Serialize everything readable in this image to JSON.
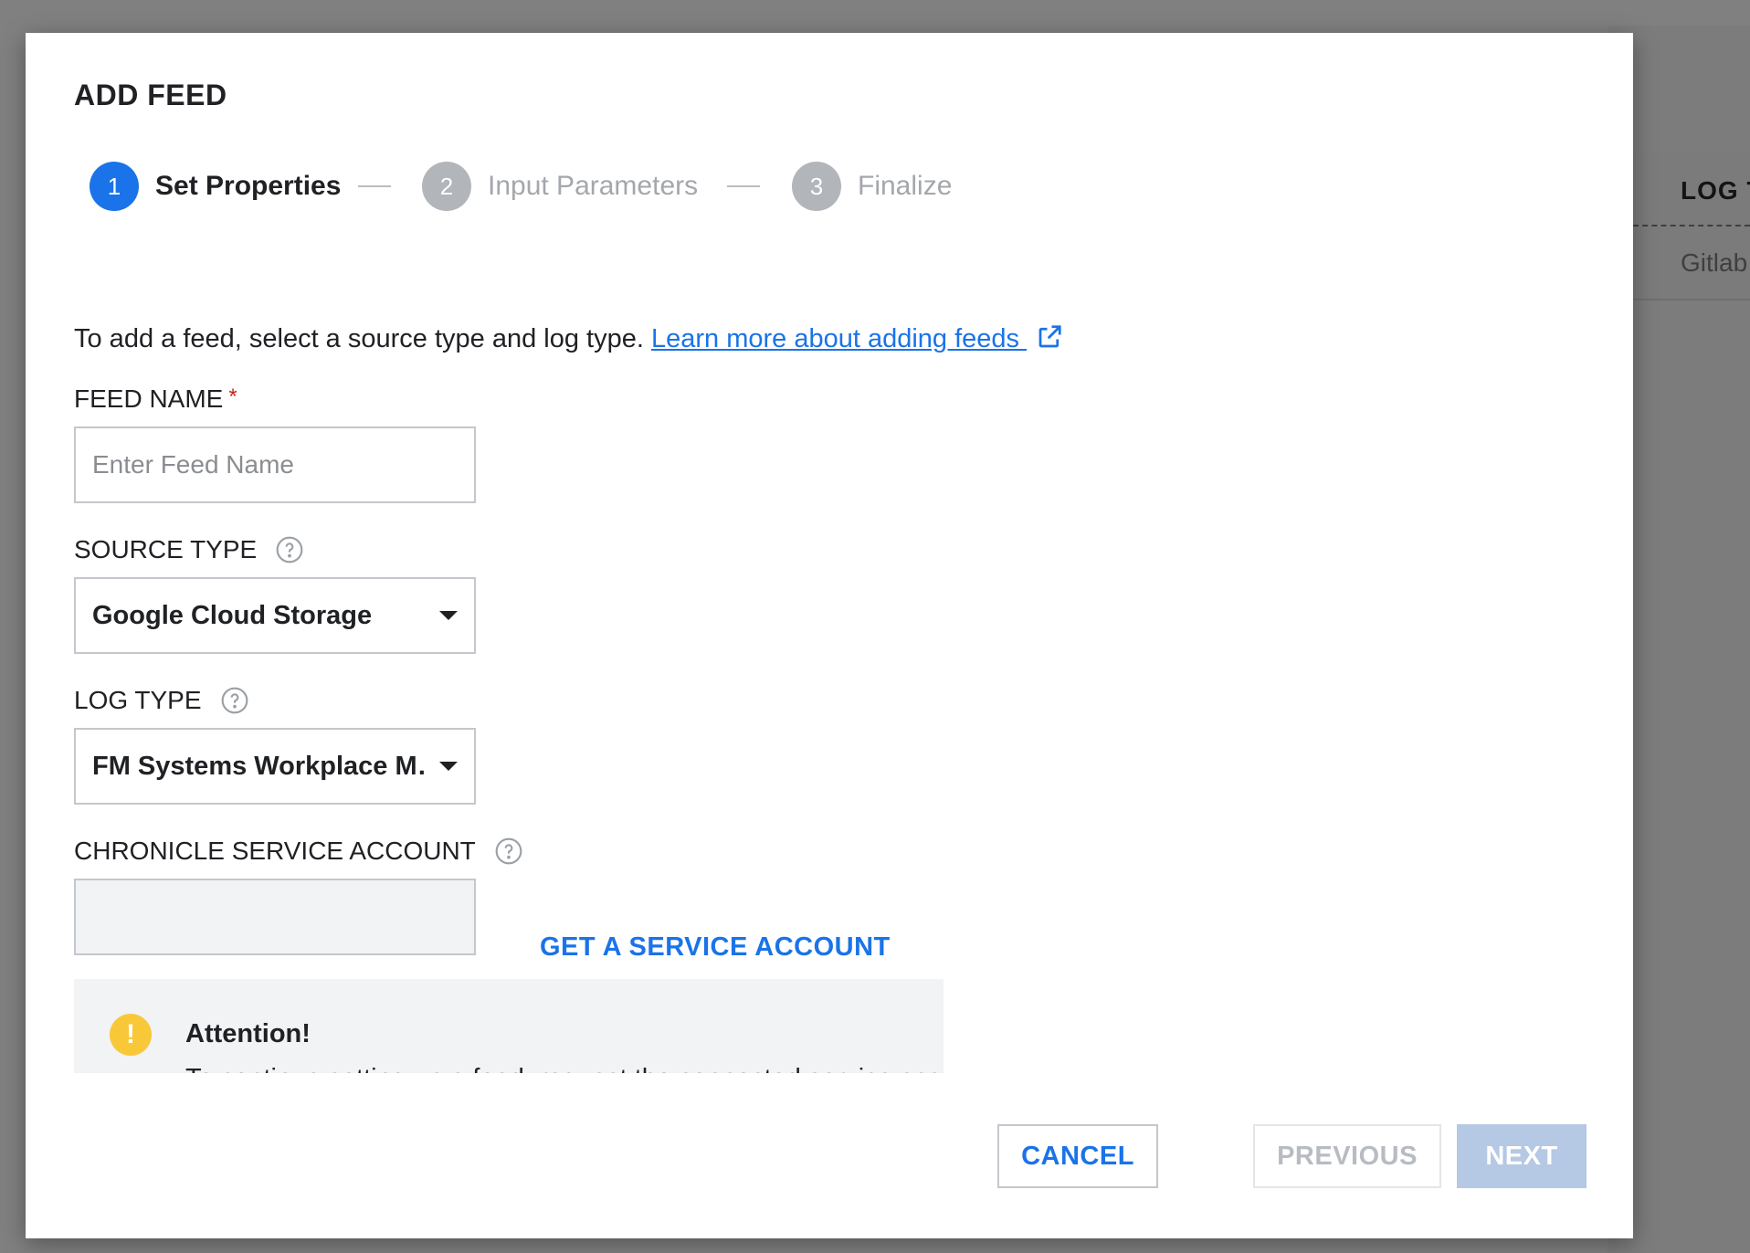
{
  "background": {
    "column_header": "LOG T",
    "cell_value": "Gitlab"
  },
  "dialog": {
    "title": "ADD FEED",
    "steps": [
      {
        "number": "1",
        "label": "Set Properties",
        "state": "active"
      },
      {
        "number": "2",
        "label": "Input Parameters",
        "state": "inactive"
      },
      {
        "number": "3",
        "label": "Finalize",
        "state": "inactive"
      }
    ],
    "intro_text": "To add a feed, select a source type and log type. ",
    "learn_more_link": "Learn more about adding feeds ",
    "feed_name": {
      "label": "FEED NAME",
      "required_mark": "*",
      "placeholder": "Enter Feed Name",
      "value": ""
    },
    "source_type": {
      "label": "SOURCE TYPE",
      "value": "Google Cloud Storage"
    },
    "log_type": {
      "label": "LOG TYPE",
      "value": "FM Systems Workplace M…"
    },
    "service_account": {
      "label": "CHRONICLE SERVICE ACCOUNT",
      "value": "",
      "get_link": "GET A SERVICE ACCOUNT"
    },
    "attention": {
      "title": "Attention!",
      "body": "To continue setting up a feed, request the connected service account"
    },
    "buttons": {
      "cancel": "CANCEL",
      "previous": "PREVIOUS",
      "next": "NEXT"
    }
  },
  "colors": {
    "accent": "#1a73e8",
    "warning": "#f9c838",
    "required": "#c5221f"
  }
}
